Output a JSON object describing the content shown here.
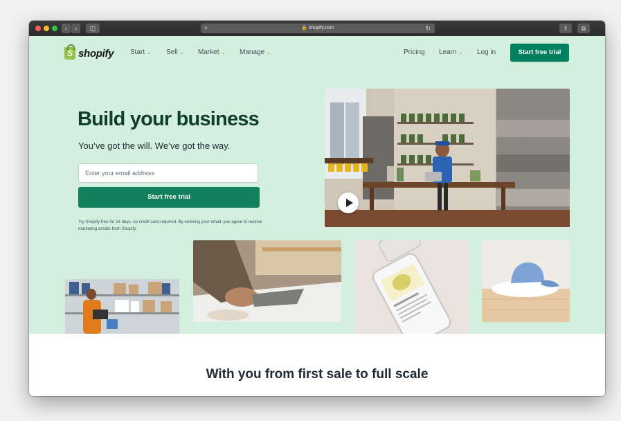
{
  "browser": {
    "url": "shopify.com"
  },
  "nav": {
    "logo_text": "shopify",
    "items": [
      {
        "label": "Start"
      },
      {
        "label": "Sell"
      },
      {
        "label": "Market"
      },
      {
        "label": "Manage"
      }
    ],
    "right_items": [
      {
        "label": "Pricing"
      },
      {
        "label": "Learn"
      },
      {
        "label": "Log in"
      }
    ],
    "cta_label": "Start free trial"
  },
  "hero": {
    "headline": "Build your business",
    "subline": "You’ve got the will. We’ve got the way.",
    "email_placeholder": "Enter your email address",
    "cta_label": "Start free trial",
    "legal": "Try Shopify free for 14 days, no credit card required. By entering your email, you agree to receive marketing emails from Shopify."
  },
  "section": {
    "title": "With you from first sale to full scale"
  },
  "colors": {
    "hero_bg": "#d3efde",
    "brand_green": "#008060",
    "headline": "#0f3d30"
  }
}
